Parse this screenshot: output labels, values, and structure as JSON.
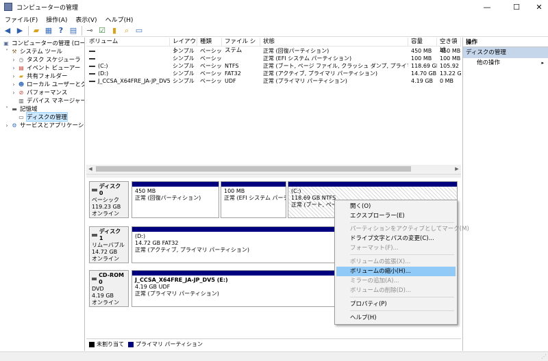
{
  "window": {
    "title": "コンピューターの管理",
    "minimize": "—",
    "maximize": "☐",
    "close": "✕"
  },
  "menu": [
    "ファイル(F)",
    "操作(A)",
    "表示(V)",
    "ヘルプ(H)"
  ],
  "tree": [
    {
      "label": "コンピューターの管理 (ローカル)",
      "expander": "",
      "icon": "computer-management-icon"
    },
    {
      "label": "システム ツール",
      "expander": "˅",
      "icon": "tools-icon"
    },
    {
      "label": "タスク スケジューラ",
      "expander": "›",
      "icon": "clock-icon"
    },
    {
      "label": "イベント ビューアー",
      "expander": "›",
      "icon": "event-viewer-icon"
    },
    {
      "label": "共有フォルダー",
      "expander": "›",
      "icon": "shared-folder-icon"
    },
    {
      "label": "ローカル ユーザーとグループ",
      "expander": "›",
      "icon": "users-icon"
    },
    {
      "label": "パフォーマンス",
      "expander": "›",
      "icon": "performance-icon"
    },
    {
      "label": "デバイス マネージャー",
      "expander": "",
      "icon": "device-manager-icon"
    },
    {
      "label": "記憶域",
      "expander": "˅",
      "icon": "storage-icon"
    },
    {
      "label": "ディスクの管理",
      "expander": "",
      "icon": "disk-icon"
    },
    {
      "label": "サービスとアプリケーション",
      "expander": "›",
      "icon": "services-icon"
    }
  ],
  "volume_table": {
    "headers": [
      "ボリューム",
      "レイアウト",
      "種類",
      "ファイル システム",
      "状態",
      "容量",
      "空き領域"
    ],
    "rows": [
      {
        "volume": "",
        "layout": "シンプル",
        "type": "ベーシック",
        "fs": "",
        "status": "正常 (回復パーティション)",
        "capacity": "450 MB",
        "free": "450 MB"
      },
      {
        "volume": "",
        "layout": "シンプル",
        "type": "ベーシック",
        "fs": "",
        "status": "正常 (EFI システム パーティション)",
        "capacity": "100 MB",
        "free": "100 MB"
      },
      {
        "volume": "(C:)",
        "layout": "シンプル",
        "type": "ベーシック",
        "fs": "NTFS",
        "status": "正常 (ブート, ページ ファイル, クラッシュ ダンプ, プライマリ パーティション)",
        "capacity": "118.69 GB",
        "free": "105.92 G"
      },
      {
        "volume": "(D:)",
        "layout": "シンプル",
        "type": "ベーシック",
        "fs": "FAT32",
        "status": "正常 (アクティブ, プライマリ パーティション)",
        "capacity": "14.70 GB",
        "free": "13.22 GB"
      },
      {
        "volume": "J_CCSA_X64FRE_JA-JP_DV5 (E:)",
        "layout": "シンプル",
        "type": "ベーシック",
        "fs": "UDF",
        "status": "正常 (プライマリ パーティション)",
        "capacity": "4.19 GB",
        "free": "0 MB"
      }
    ]
  },
  "disks": [
    {
      "name": "ディスク 0",
      "kind": "ベーシック",
      "size": "119.23 GB",
      "state": "オンライン",
      "partitions": [
        {
          "title": "",
          "line1": "450 MB",
          "line2": "正常 (回復パーティション)"
        },
        {
          "title": "",
          "line1": "100 MB",
          "line2": "正常 (EFI システム パーティショ"
        },
        {
          "title": "(C:)",
          "line1": "118.69 GB NTFS",
          "line2": "正常 (ブート, ページ フ"
        }
      ]
    },
    {
      "name": "ディスク 1",
      "kind": "リムーバブル",
      "size": "14.72 GB",
      "state": "オンライン",
      "partitions": [
        {
          "title": "(D:)",
          "line1": "14.72 GB FAT32",
          "line2": "正常 (アクティブ, プライマリ パーティション)"
        }
      ]
    },
    {
      "name": "CD-ROM 0",
      "kind": "DVD",
      "size": "4.19 GB",
      "state": "オンライン",
      "partitions": [
        {
          "title": "J_CCSA_X64FRE_JA-JP_DV5  (E:)",
          "line1": "4.19 GB UDF",
          "line2": "正常 (プライマリ パーティション)"
        }
      ]
    }
  ],
  "legend": [
    {
      "label": "未割り当て",
      "color": "#000000"
    },
    {
      "label": "プライマリ パーティション",
      "color": "#00007f"
    }
  ],
  "actions": {
    "header": "操作",
    "section": "ディスクの管理",
    "other": "他の操作",
    "arrow": "▸"
  },
  "context_menu": [
    {
      "label": "開く(O)",
      "enabled": true
    },
    {
      "label": "エクスプローラー(E)",
      "enabled": true
    },
    {
      "label": "パーティションをアクティブとしてマーク(M)",
      "enabled": false
    },
    {
      "label": "ドライブ文字とパスの変更(C)...",
      "enabled": true
    },
    {
      "label": "フォーマット(F)...",
      "enabled": false
    },
    {
      "label": "ボリュームの拡張(X)...",
      "enabled": false
    },
    {
      "label": "ボリュームの縮小(H)...",
      "enabled": true,
      "highlighted": true
    },
    {
      "label": "ミラーの追加(A)...",
      "enabled": false
    },
    {
      "label": "ボリュームの削除(D)...",
      "enabled": false
    },
    {
      "label": "プロパティ(P)",
      "enabled": true
    },
    {
      "label": "ヘルプ(H)",
      "enabled": true
    }
  ],
  "colors": {
    "partition_bar": "#00007f",
    "selection": "#cce8ff",
    "menu_highlight": "#91c9f7",
    "actions_section": "#c5d5ea"
  }
}
